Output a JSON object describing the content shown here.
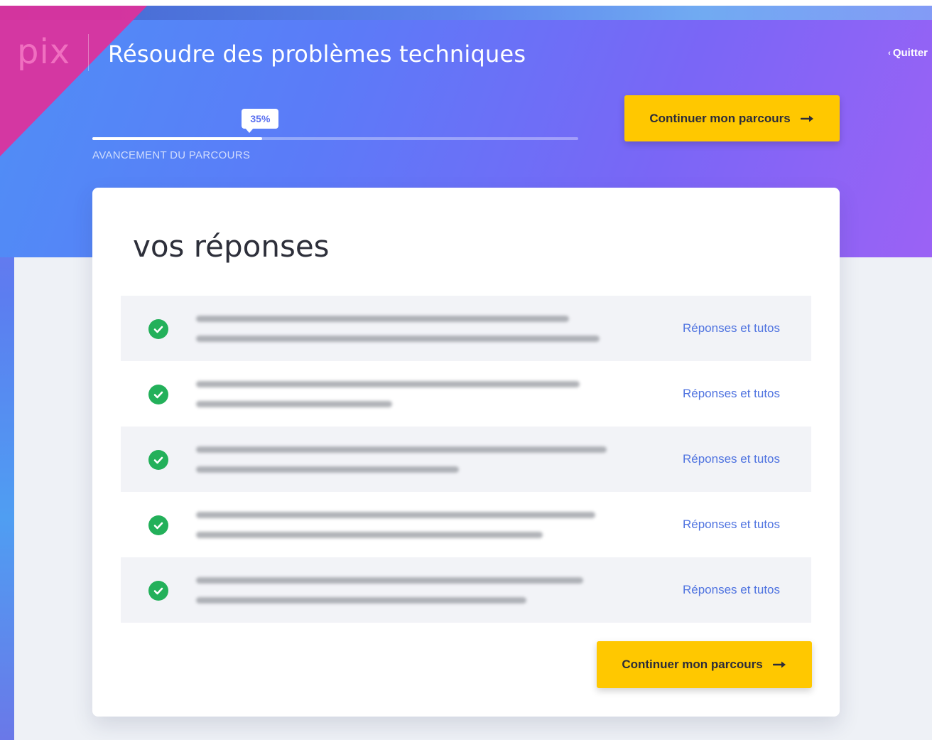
{
  "header": {
    "logo": "pix",
    "title": "Résoudre des problèmes techniques",
    "quit_label": "Quitter"
  },
  "progress": {
    "percent": 35,
    "bubble_label": "35%",
    "caption": "AVANCEMENT DU PARCOURS"
  },
  "continue_button": {
    "label": "Continuer mon parcours",
    "icon": "arrow-right-icon"
  },
  "results": {
    "title": "vos réponses",
    "items": [
      {
        "status": "correct",
        "status_icon": "check-circle-icon",
        "question": "",
        "link_label": "Réponses et tutos"
      },
      {
        "status": "correct",
        "status_icon": "check-circle-icon",
        "question": "",
        "link_label": "Réponses et tutos"
      },
      {
        "status": "correct",
        "status_icon": "check-circle-icon",
        "question": "",
        "link_label": "Réponses et tutos"
      },
      {
        "status": "correct",
        "status_icon": "check-circle-icon",
        "question": "",
        "link_label": "Réponses et tutos"
      },
      {
        "status": "correct",
        "status_icon": "check-circle-icon",
        "question": "",
        "link_label": "Réponses et tutos"
      }
    ]
  },
  "colors": {
    "accent_button": "#ffc800",
    "success": "#23b05a",
    "link": "#4f73e0",
    "logo": "#f06fc0"
  }
}
